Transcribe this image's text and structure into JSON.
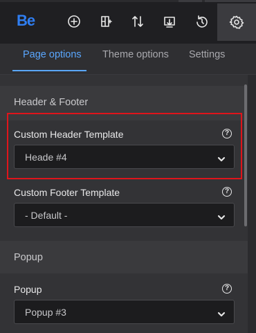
{
  "toolbar": {
    "logo": "Be",
    "icons": [
      "add-icon",
      "layout-add-icon",
      "sort-arrows-icon",
      "import-export-icon",
      "history-icon",
      "settings-gear-icon"
    ]
  },
  "tabs": [
    {
      "label": "Page options",
      "active": true
    },
    {
      "label": "Theme options",
      "active": false
    },
    {
      "label": "Settings",
      "active": false
    }
  ],
  "sections": {
    "header_footer": {
      "title": "Header & Footer",
      "custom_header": {
        "label": "Custom Header Template",
        "value": "Heade #4"
      },
      "custom_footer": {
        "label": "Custom Footer Template",
        "value": "- Default -"
      }
    },
    "popup": {
      "title": "Popup",
      "field": {
        "label": "Popup",
        "value": "Popup #3"
      }
    }
  },
  "help_glyph": "?",
  "colors": {
    "accent": "#5aa7ff",
    "logo": "#2f7ef2",
    "highlight": "#e0141b",
    "toolbar_bg": "#1f1f22",
    "panel_bg": "#333336"
  }
}
